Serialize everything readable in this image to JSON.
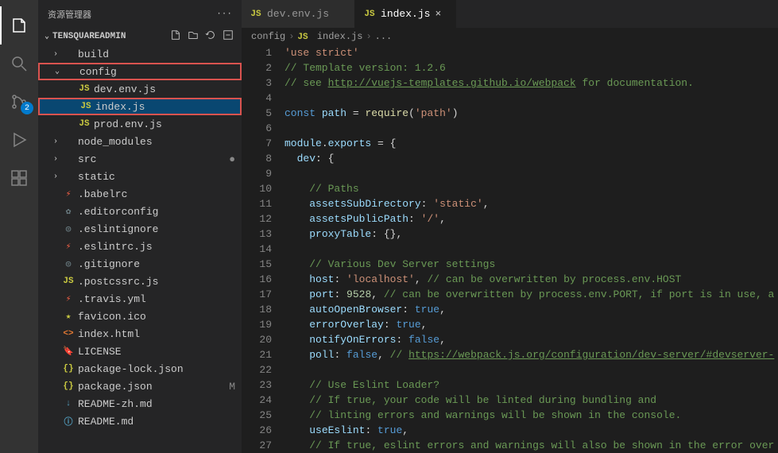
{
  "sidebarTitle": "资源管理器",
  "projectName": "TENSQUAREADMIN",
  "sourceControlBadge": "2",
  "tree": [
    {
      "indent": 14,
      "chev": "›",
      "icon": "",
      "iconClass": "ic-folder",
      "label": "build",
      "selected": false,
      "highlighted": false,
      "mod": ""
    },
    {
      "indent": 14,
      "chev": "⌄",
      "icon": "",
      "iconClass": "ic-folder",
      "label": "config",
      "selected": false,
      "highlighted": true,
      "mod": ""
    },
    {
      "indent": 34,
      "chev": "",
      "icon": "JS",
      "iconClass": "ic-js",
      "label": "dev.env.js",
      "selected": false,
      "highlighted": false,
      "mod": ""
    },
    {
      "indent": 34,
      "chev": "",
      "icon": "JS",
      "iconClass": "ic-js",
      "label": "index.js",
      "selected": true,
      "highlighted": true,
      "mod": ""
    },
    {
      "indent": 34,
      "chev": "",
      "icon": "JS",
      "iconClass": "ic-js",
      "label": "prod.env.js",
      "selected": false,
      "highlighted": false,
      "mod": ""
    },
    {
      "indent": 14,
      "chev": "›",
      "icon": "",
      "iconClass": "ic-folder",
      "label": "node_modules",
      "selected": false,
      "highlighted": false,
      "mod": ""
    },
    {
      "indent": 14,
      "chev": "›",
      "icon": "",
      "iconClass": "ic-folder",
      "label": "src",
      "selected": false,
      "highlighted": false,
      "mod": "●"
    },
    {
      "indent": 14,
      "chev": "›",
      "icon": "",
      "iconClass": "ic-folder",
      "label": "static",
      "selected": false,
      "highlighted": false,
      "mod": ""
    },
    {
      "indent": 14,
      "chev": "",
      "icon": "⚡",
      "iconClass": "ic-yml",
      "label": ".babelrc",
      "selected": false,
      "highlighted": false,
      "mod": ""
    },
    {
      "indent": 14,
      "chev": "",
      "icon": "✿",
      "iconClass": "ic-dot",
      "label": ".editorconfig",
      "selected": false,
      "highlighted": false,
      "mod": ""
    },
    {
      "indent": 14,
      "chev": "",
      "icon": "◎",
      "iconClass": "ic-dot",
      "label": ".eslintignore",
      "selected": false,
      "highlighted": false,
      "mod": ""
    },
    {
      "indent": 14,
      "chev": "",
      "icon": "⚡",
      "iconClass": "ic-yml",
      "label": ".eslintrc.js",
      "selected": false,
      "highlighted": false,
      "mod": ""
    },
    {
      "indent": 14,
      "chev": "",
      "icon": "◎",
      "iconClass": "ic-dot",
      "label": ".gitignore",
      "selected": false,
      "highlighted": false,
      "mod": ""
    },
    {
      "indent": 14,
      "chev": "",
      "icon": "JS",
      "iconClass": "ic-js",
      "label": ".postcssrc.js",
      "selected": false,
      "highlighted": false,
      "mod": ""
    },
    {
      "indent": 14,
      "chev": "",
      "icon": "⚡",
      "iconClass": "ic-yml",
      "label": ".travis.yml",
      "selected": false,
      "highlighted": false,
      "mod": ""
    },
    {
      "indent": 14,
      "chev": "",
      "icon": "★",
      "iconClass": "ic-star",
      "label": "favicon.ico",
      "selected": false,
      "highlighted": false,
      "mod": ""
    },
    {
      "indent": 14,
      "chev": "",
      "icon": "<>",
      "iconClass": "ic-html",
      "label": "index.html",
      "selected": false,
      "highlighted": false,
      "mod": ""
    },
    {
      "indent": 14,
      "chev": "",
      "icon": "🔖",
      "iconClass": "ic-lic",
      "label": "LICENSE",
      "selected": false,
      "highlighted": false,
      "mod": ""
    },
    {
      "indent": 14,
      "chev": "",
      "icon": "{}",
      "iconClass": "ic-json",
      "label": "package-lock.json",
      "selected": false,
      "highlighted": false,
      "mod": ""
    },
    {
      "indent": 14,
      "chev": "",
      "icon": "{}",
      "iconClass": "ic-json",
      "label": "package.json",
      "selected": false,
      "highlighted": false,
      "mod": "M"
    },
    {
      "indent": 14,
      "chev": "",
      "icon": "↓",
      "iconClass": "ic-md",
      "label": "README-zh.md",
      "selected": false,
      "highlighted": false,
      "mod": ""
    },
    {
      "indent": 14,
      "chev": "",
      "icon": "ⓘ",
      "iconClass": "ic-md",
      "label": "README.md",
      "selected": false,
      "highlighted": false,
      "mod": ""
    }
  ],
  "tabs": [
    {
      "icon": "JS",
      "label": "dev.env.js",
      "active": false
    },
    {
      "icon": "JS",
      "label": "index.js",
      "active": true
    }
  ],
  "breadcrumb": [
    "config",
    "index.js",
    "..."
  ],
  "code": [
    [
      {
        "cls": "tk-str",
        "t": "'use strict'"
      }
    ],
    [
      {
        "cls": "tk-cmt",
        "t": "// Template version: 1.2.6"
      }
    ],
    [
      {
        "cls": "tk-cmt",
        "t": "// see "
      },
      {
        "cls": "tk-cmt tk-link",
        "t": "http://vuejs-templates.github.io/webpack"
      },
      {
        "cls": "tk-cmt",
        "t": " for documentation."
      }
    ],
    [],
    [
      {
        "cls": "tk-kw",
        "t": "const"
      },
      {
        "cls": "tk-pl",
        "t": " "
      },
      {
        "cls": "tk-var",
        "t": "path"
      },
      {
        "cls": "tk-pl",
        "t": " = "
      },
      {
        "cls": "tk-fn",
        "t": "require"
      },
      {
        "cls": "tk-pl",
        "t": "("
      },
      {
        "cls": "tk-str",
        "t": "'path'"
      },
      {
        "cls": "tk-pl",
        "t": ")"
      }
    ],
    [],
    [
      {
        "cls": "tk-var",
        "t": "module"
      },
      {
        "cls": "tk-pl",
        "t": "."
      },
      {
        "cls": "tk-var",
        "t": "exports"
      },
      {
        "cls": "tk-pl",
        "t": " = {"
      }
    ],
    [
      {
        "cls": "tk-pl",
        "t": "  "
      },
      {
        "cls": "tk-var",
        "t": "dev"
      },
      {
        "cls": "tk-pl",
        "t": ": {"
      }
    ],
    [],
    [
      {
        "cls": "tk-pl",
        "t": "    "
      },
      {
        "cls": "tk-cmt",
        "t": "// Paths"
      }
    ],
    [
      {
        "cls": "tk-pl",
        "t": "    "
      },
      {
        "cls": "tk-var",
        "t": "assetsSubDirectory"
      },
      {
        "cls": "tk-pl",
        "t": ": "
      },
      {
        "cls": "tk-str",
        "t": "'static'"
      },
      {
        "cls": "tk-pl",
        "t": ","
      }
    ],
    [
      {
        "cls": "tk-pl",
        "t": "    "
      },
      {
        "cls": "tk-var",
        "t": "assetsPublicPath"
      },
      {
        "cls": "tk-pl",
        "t": ": "
      },
      {
        "cls": "tk-str",
        "t": "'/'"
      },
      {
        "cls": "tk-pl",
        "t": ","
      }
    ],
    [
      {
        "cls": "tk-pl",
        "t": "    "
      },
      {
        "cls": "tk-var",
        "t": "proxyTable"
      },
      {
        "cls": "tk-pl",
        "t": ": {},"
      }
    ],
    [],
    [
      {
        "cls": "tk-pl",
        "t": "    "
      },
      {
        "cls": "tk-cmt",
        "t": "// Various Dev Server settings"
      }
    ],
    [
      {
        "cls": "tk-pl",
        "t": "    "
      },
      {
        "cls": "tk-var",
        "t": "host"
      },
      {
        "cls": "tk-pl",
        "t": ": "
      },
      {
        "cls": "tk-str",
        "t": "'localhost'"
      },
      {
        "cls": "tk-pl",
        "t": ", "
      },
      {
        "cls": "tk-cmt",
        "t": "// can be overwritten by process.env.HOST"
      }
    ],
    [
      {
        "cls": "tk-pl",
        "t": "    "
      },
      {
        "cls": "tk-var",
        "t": "port"
      },
      {
        "cls": "tk-pl",
        "t": ": "
      },
      {
        "cls": "tk-num",
        "t": "9528"
      },
      {
        "cls": "tk-pl",
        "t": ", "
      },
      {
        "cls": "tk-cmt",
        "t": "// can be overwritten by process.env.PORT, if port is in use, a"
      }
    ],
    [
      {
        "cls": "tk-pl",
        "t": "    "
      },
      {
        "cls": "tk-var",
        "t": "autoOpenBrowser"
      },
      {
        "cls": "tk-pl",
        "t": ": "
      },
      {
        "cls": "tk-kw",
        "t": "true"
      },
      {
        "cls": "tk-pl",
        "t": ","
      }
    ],
    [
      {
        "cls": "tk-pl",
        "t": "    "
      },
      {
        "cls": "tk-var",
        "t": "errorOverlay"
      },
      {
        "cls": "tk-pl",
        "t": ": "
      },
      {
        "cls": "tk-kw",
        "t": "true"
      },
      {
        "cls": "tk-pl",
        "t": ","
      }
    ],
    [
      {
        "cls": "tk-pl",
        "t": "    "
      },
      {
        "cls": "tk-var",
        "t": "notifyOnErrors"
      },
      {
        "cls": "tk-pl",
        "t": ": "
      },
      {
        "cls": "tk-kw",
        "t": "false"
      },
      {
        "cls": "tk-pl",
        "t": ","
      }
    ],
    [
      {
        "cls": "tk-pl",
        "t": "    "
      },
      {
        "cls": "tk-var",
        "t": "poll"
      },
      {
        "cls": "tk-pl",
        "t": ": "
      },
      {
        "cls": "tk-kw",
        "t": "false"
      },
      {
        "cls": "tk-pl",
        "t": ", "
      },
      {
        "cls": "tk-cmt",
        "t": "// "
      },
      {
        "cls": "tk-cmt tk-link",
        "t": "https://webpack.js.org/configuration/dev-server/#devserver-"
      }
    ],
    [],
    [
      {
        "cls": "tk-pl",
        "t": "    "
      },
      {
        "cls": "tk-cmt",
        "t": "// Use Eslint Loader?"
      }
    ],
    [
      {
        "cls": "tk-pl",
        "t": "    "
      },
      {
        "cls": "tk-cmt",
        "t": "// If true, your code will be linted during bundling and"
      }
    ],
    [
      {
        "cls": "tk-pl",
        "t": "    "
      },
      {
        "cls": "tk-cmt",
        "t": "// linting errors and warnings will be shown in the console."
      }
    ],
    [
      {
        "cls": "tk-pl",
        "t": "    "
      },
      {
        "cls": "tk-var",
        "t": "useEslint"
      },
      {
        "cls": "tk-pl",
        "t": ": "
      },
      {
        "cls": "tk-kw",
        "t": "true"
      },
      {
        "cls": "tk-pl",
        "t": ","
      }
    ],
    [
      {
        "cls": "tk-pl",
        "t": "    "
      },
      {
        "cls": "tk-cmt",
        "t": "// If true, eslint errors and warnings will also be shown in the error over"
      }
    ]
  ]
}
